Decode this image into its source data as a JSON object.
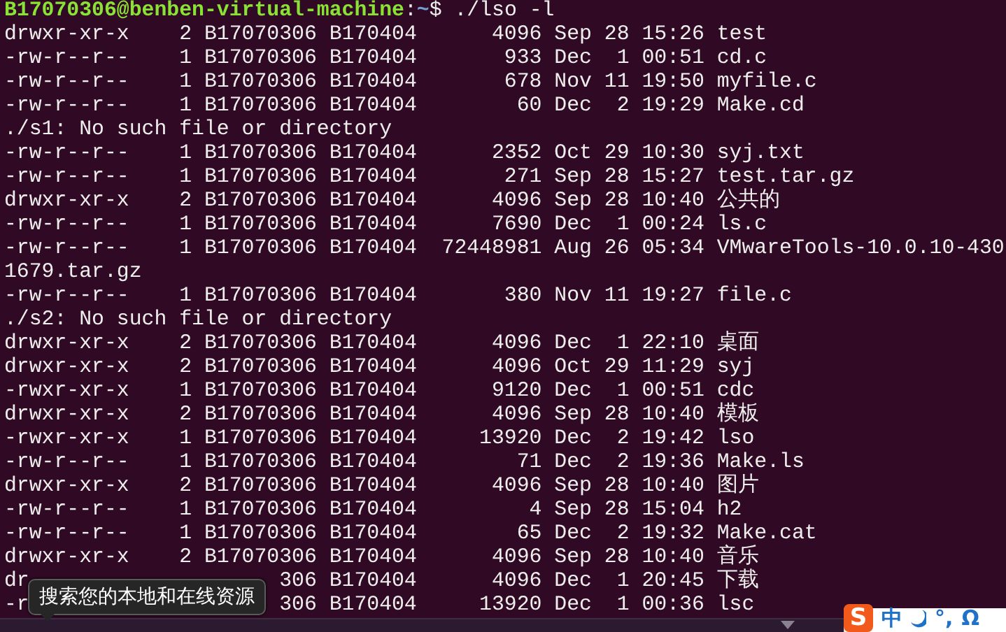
{
  "terminal": {
    "lines": [
      {
        "kind": "prompt",
        "user_host": "B17070306@benben-virtual-machine",
        "separator": ":",
        "path": "~",
        "symbol": "$",
        "command": "./lso -l"
      },
      {
        "kind": "output",
        "text": "drwxr-xr-x    2 B17070306 B170404      4096 Sep 28 15:26 test"
      },
      {
        "kind": "output",
        "text": "-rw-r--r--    1 B17070306 B170404       933 Dec  1 00:51 cd.c"
      },
      {
        "kind": "output",
        "text": "-rw-r--r--    1 B17070306 B170404       678 Nov 11 19:50 myfile.c"
      },
      {
        "kind": "output",
        "text": "-rw-r--r--    1 B17070306 B170404        60 Dec  2 19:29 Make.cd"
      },
      {
        "kind": "output",
        "text": "./s1: No such file or directory"
      },
      {
        "kind": "output",
        "text": "-rw-r--r--    1 B17070306 B170404      2352 Oct 29 10:30 syj.txt"
      },
      {
        "kind": "output",
        "text": "-rw-r--r--    1 B17070306 B170404       271 Sep 28 15:27 test.tar.gz"
      },
      {
        "kind": "output",
        "text": "drwxr-xr-x    2 B17070306 B170404      4096 Sep 28 10:40 公共的"
      },
      {
        "kind": "output",
        "text": "-rw-r--r--    1 B17070306 B170404      7690 Dec  1 00:24 ls.c"
      },
      {
        "kind": "output",
        "text": "-rw-r--r--    1 B17070306 B170404  72448981 Aug 26 05:34 VMwareTools-10.0.10-430"
      },
      {
        "kind": "output",
        "text": "1679.tar.gz"
      },
      {
        "kind": "output",
        "text": "-rw-r--r--    1 B17070306 B170404       380 Nov 11 19:27 file.c"
      },
      {
        "kind": "output",
        "text": "./s2: No such file or directory"
      },
      {
        "kind": "output",
        "text": "drwxr-xr-x    2 B17070306 B170404      4096 Dec  1 22:10 桌面"
      },
      {
        "kind": "output",
        "text": "drwxr-xr-x    2 B17070306 B170404      4096 Oct 29 11:29 syj"
      },
      {
        "kind": "output",
        "text": "-rwxr-xr-x    1 B17070306 B170404      9120 Dec  1 00:51 cdc"
      },
      {
        "kind": "output",
        "text": "drwxr-xr-x    2 B17070306 B170404      4096 Sep 28 10:40 模板"
      },
      {
        "kind": "output",
        "text": "-rwxr-xr-x    1 B17070306 B170404     13920 Dec  2 19:42 lso"
      },
      {
        "kind": "output",
        "text": "-rw-r--r--    1 B17070306 B170404        71 Dec  2 19:36 Make.ls"
      },
      {
        "kind": "output",
        "text": "drwxr-xr-x    2 B17070306 B170404      4096 Sep 28 10:40 图片"
      },
      {
        "kind": "output",
        "text": "-rw-r--r--    1 B17070306 B170404         4 Sep 28 15:04 h2"
      },
      {
        "kind": "output",
        "text": "-rw-r--r--    1 B17070306 B170404        65 Dec  2 19:32 Make.cat"
      },
      {
        "kind": "output",
        "text": "drwxr-xr-x    2 B17070306 B170404      4096 Sep 28 10:40 音乐"
      },
      {
        "kind": "partial",
        "lead": "dr",
        "rest": "306 B170404      4096 Dec  1 20:45 下载"
      },
      {
        "kind": "partial",
        "lead": "-r",
        "rest": "306 B170404     13920 Dec  1 00:36 lsc"
      }
    ]
  },
  "tooltip": {
    "text": "搜索您的本地和在线资源"
  },
  "input_method": {
    "logo": "S",
    "mode": "中",
    "punctuation": "°,",
    "symbols": "Ω"
  }
}
